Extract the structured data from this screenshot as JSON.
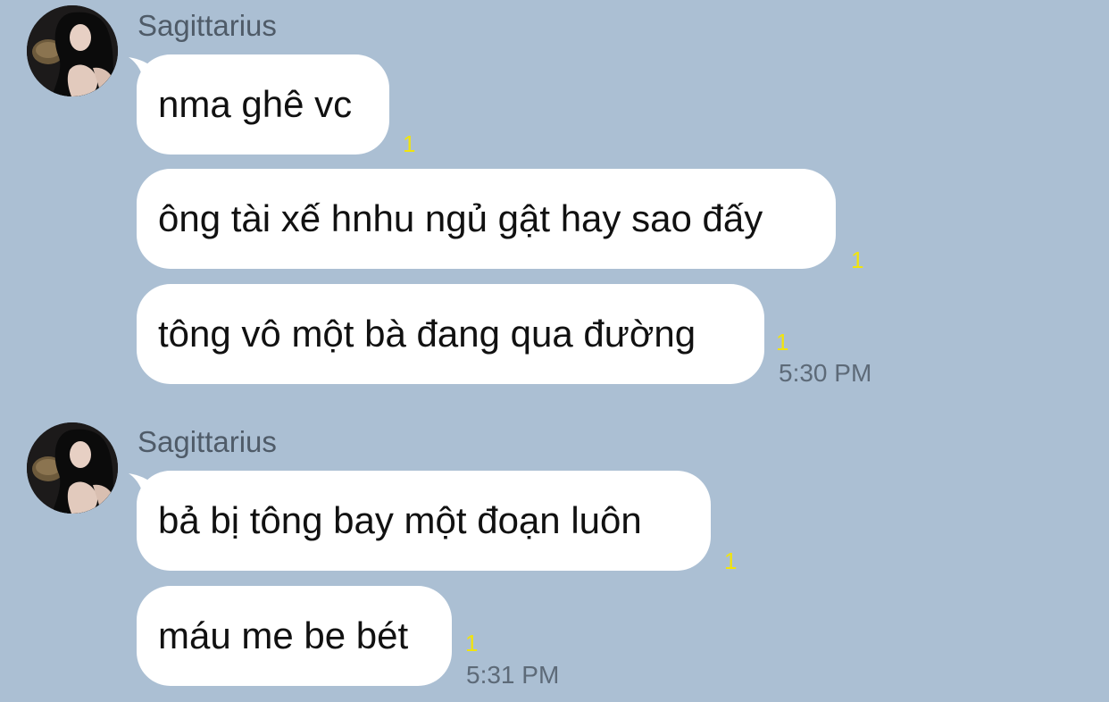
{
  "groups": [
    {
      "sender": "Sagittarius",
      "messages": [
        {
          "text": "nma ghê vc",
          "read_count": "1"
        },
        {
          "text": "ông tài xế hnhu ngủ gật hay sao đấy",
          "read_count": "1"
        },
        {
          "text": "tông vô một bà đang qua đường",
          "read_count": "1",
          "time": "5:30 PM"
        }
      ]
    },
    {
      "sender": "Sagittarius",
      "messages": [
        {
          "text": "bả bị tông bay một đoạn luôn",
          "read_count": "1"
        },
        {
          "text": "máu me be bét",
          "read_count": "1",
          "time": "5:31 PM"
        }
      ]
    }
  ]
}
